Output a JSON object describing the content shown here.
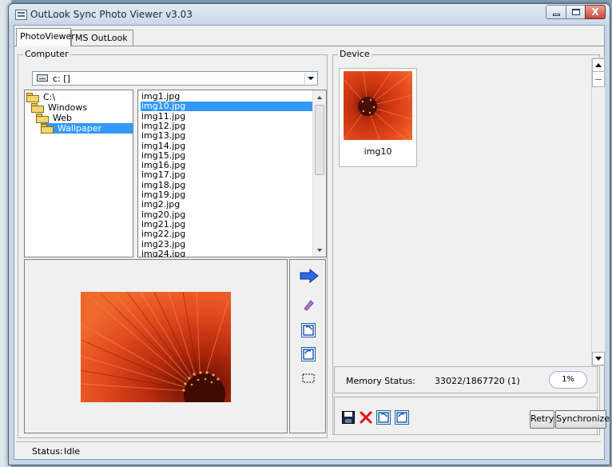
{
  "window": {
    "title": "OutLook Sync Photo Viewer v3.03",
    "close_glyph": "X"
  },
  "tabs": [
    {
      "label": "PhotoViewer",
      "active": true
    },
    {
      "label": "MS OutLook",
      "active": false
    }
  ],
  "computer": {
    "group_label": "Computer",
    "drive": "c: []",
    "folders": [
      {
        "label": "C:\\",
        "depth": 0,
        "selected": false
      },
      {
        "label": "Windows",
        "depth": 1,
        "selected": false
      },
      {
        "label": "Web",
        "depth": 2,
        "selected": false
      },
      {
        "label": "Wallpaper",
        "depth": 3,
        "selected": true
      }
    ],
    "files": [
      "img1.jpg",
      "img10.jpg",
      "img11.jpg",
      "img12.jpg",
      "img13.jpg",
      "img14.jpg",
      "img15.jpg",
      "img16.jpg",
      "img17.jpg",
      "img18.jpg",
      "img19.jpg",
      "img2.jpg",
      "img20.jpg",
      "img21.jpg",
      "img22.jpg",
      "img23.jpg",
      "img24.jpg"
    ],
    "selected_file": "img10.jpg"
  },
  "tools": [
    "send-arrow-icon",
    "eraser-icon",
    "rotate-right-icon",
    "rotate-left-icon",
    "crop-icon"
  ],
  "device": {
    "group_label": "Device",
    "thumbnails": [
      {
        "label": "img10"
      }
    ]
  },
  "memory": {
    "label": "Memory Status:",
    "value": "33022/1867720 (1)",
    "percent_text": "1%",
    "percent": 1
  },
  "actions": {
    "icons": [
      "save-icon",
      "delete-icon",
      "rotate-right-icon",
      "rotate-left-icon"
    ],
    "retry_label": "Retry",
    "sync_label": "Synchronize"
  },
  "status": {
    "label": "Status:",
    "value": "Idle"
  },
  "colors": {
    "selection": "#3399ff",
    "flower_red": "#d8371a",
    "arrow_blue": "#2a6ae6",
    "delete_red": "#e01010"
  }
}
